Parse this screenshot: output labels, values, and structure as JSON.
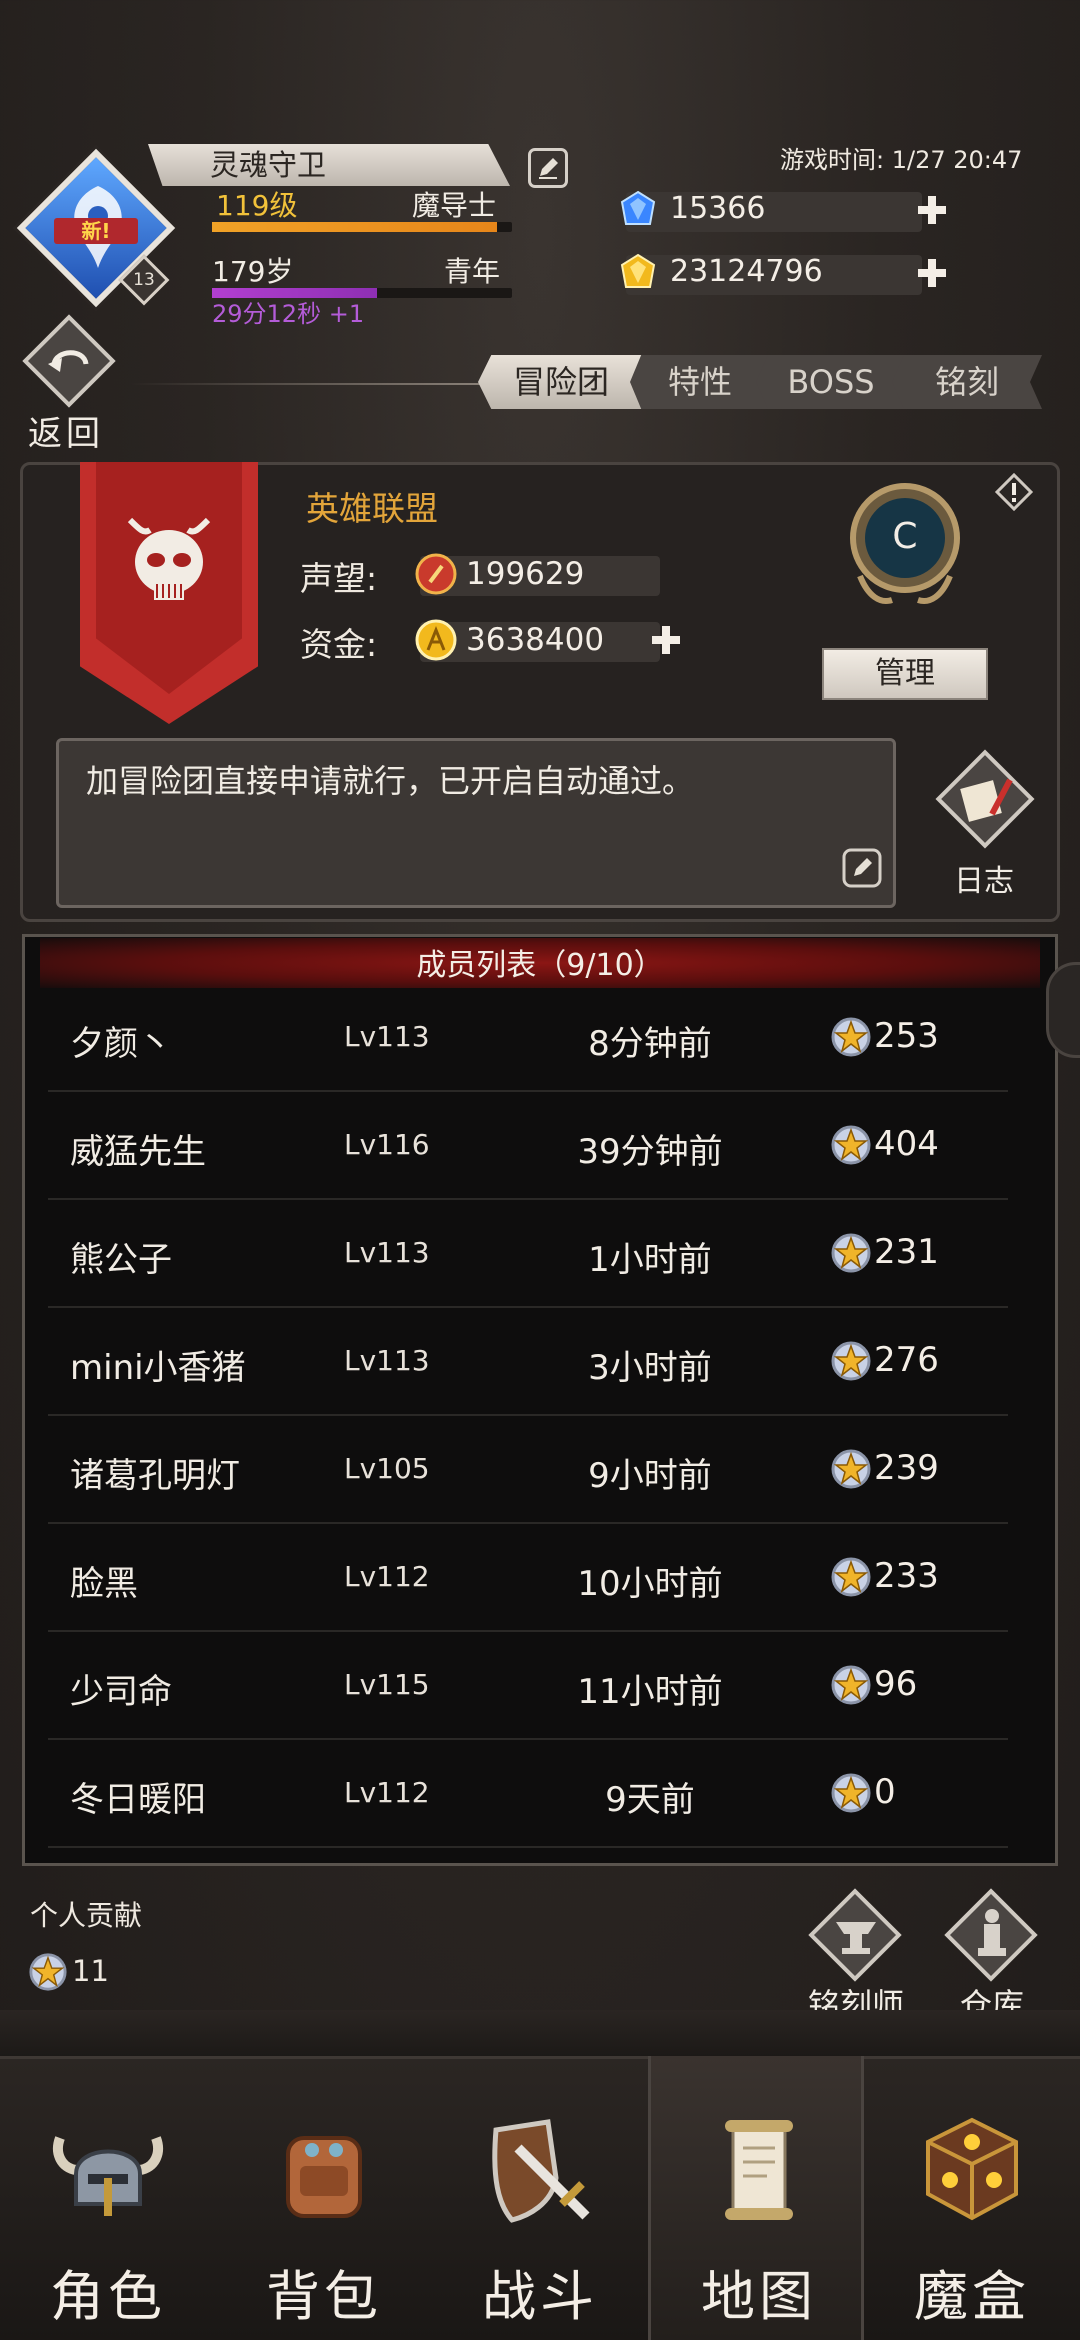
{
  "header": {
    "player_name": "灵魂守卫",
    "level": "119级",
    "class": "魔导士",
    "age": "179岁",
    "stage": "青年",
    "age_timer": "29分12秒 +1",
    "avatar_badge": "新!",
    "avatar_level": "13",
    "game_time": "游戏时间: 1/27 20:47",
    "gems": "15366",
    "gold": "23124796",
    "level_progress": 0.95,
    "age_progress": 0.55
  },
  "nav_top": {
    "back_label": "返回",
    "tabs": [
      "冒险团",
      "特性",
      "BOSS",
      "铭刻"
    ]
  },
  "guild": {
    "name": "英雄联盟",
    "reputation_label": "声望:",
    "reputation": "199629",
    "funds_label": "资金:",
    "funds": "3638400",
    "rank": "C",
    "manage_label": "管理",
    "notice": "加冒险团直接申请就行，已开启自动通过。",
    "log_label": "日志"
  },
  "members": {
    "title": "成员列表（9/10）",
    "rows": [
      {
        "name": "夕颜丶",
        "level": "Lv113",
        "last_seen": "8分钟前",
        "contribution": "253"
      },
      {
        "name": "威猛先生",
        "level": "Lv116",
        "last_seen": "39分钟前",
        "contribution": "404"
      },
      {
        "name": "熊公子",
        "level": "Lv113",
        "last_seen": "1小时前",
        "contribution": "231"
      },
      {
        "name": "mini小香猪",
        "level": "Lv113",
        "last_seen": "3小时前",
        "contribution": "276"
      },
      {
        "name": "诸葛孔明灯",
        "level": "Lv105",
        "last_seen": "9小时前",
        "contribution": "239"
      },
      {
        "name": "脸黑",
        "level": "Lv112",
        "last_seen": "10小时前",
        "contribution": "233"
      },
      {
        "name": "少司命",
        "level": "Lv115",
        "last_seen": "11小时前",
        "contribution": "96"
      },
      {
        "name": "冬日暖阳",
        "level": "Lv112",
        "last_seen": "9天前",
        "contribution": "0"
      }
    ]
  },
  "footer": {
    "personal_label": "个人贡献",
    "personal_value": "11",
    "engraver_label": "铭刻师",
    "storage_label": "仓库"
  },
  "bottom_nav": {
    "items": [
      "角色",
      "背包",
      "战斗",
      "地图",
      "魔盒"
    ],
    "active": "地图"
  },
  "colors": {
    "accent_gold": "#e3a53a",
    "level_bar": "#f1a227",
    "age_bar": "#b23fd1",
    "banner_red": "#c22e2b",
    "header_red": "#8b1614"
  }
}
